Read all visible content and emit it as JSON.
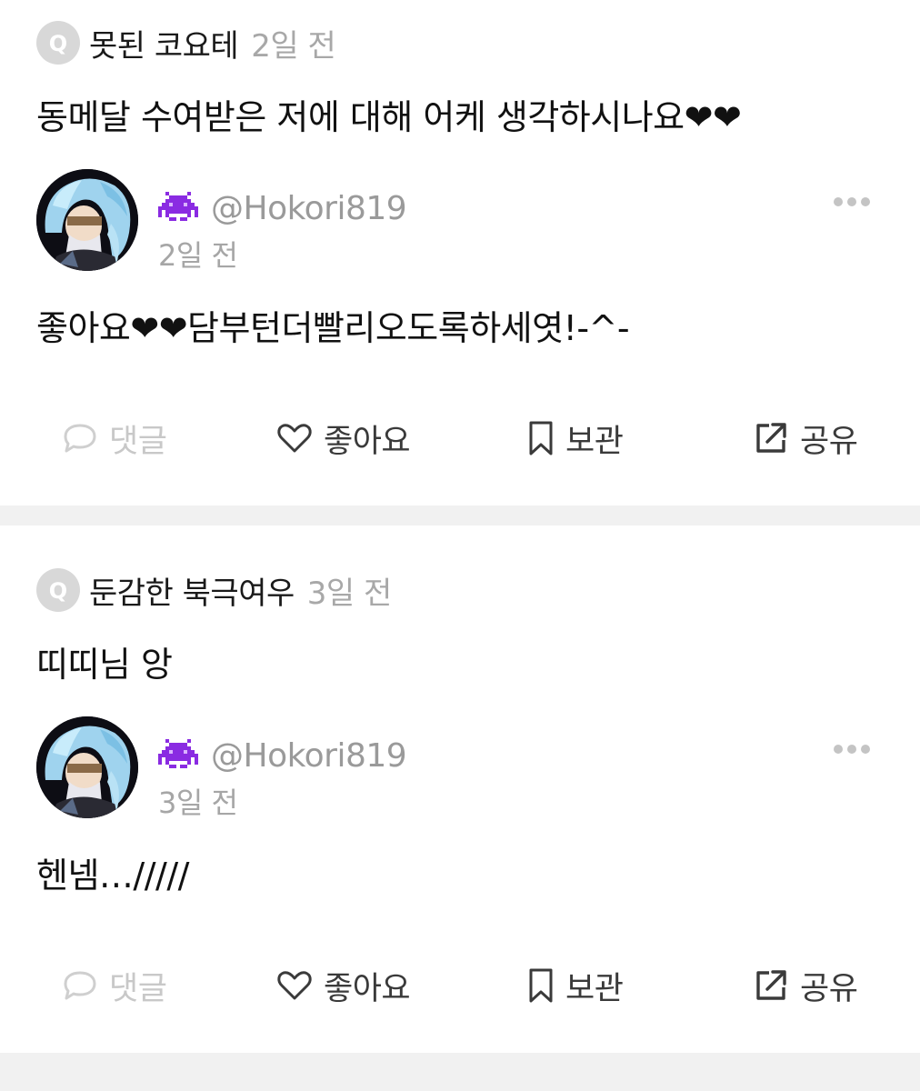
{
  "posts": [
    {
      "question": {
        "badge": "Q",
        "author": "못된 코요테",
        "time": "2일 전",
        "text": "동메달 수여받은 저에 대해 어케 생각하시나요❤❤"
      },
      "answer": {
        "handle": "@Hokori819",
        "time": "2일 전",
        "text": "좋아요❤❤담부턴더빨리오도록하세엿!-^-"
      },
      "actions": {
        "comment": "댓글",
        "like": "좋아요",
        "save": "보관",
        "share": "공유"
      }
    },
    {
      "question": {
        "badge": "Q",
        "author": "둔감한 북극여우",
        "time": "3일 전",
        "text": "띠띠님 앙"
      },
      "answer": {
        "handle": "@Hokori819",
        "time": "3일 전",
        "text": "헨넴…/////"
      },
      "actions": {
        "comment": "댓글",
        "like": "좋아요",
        "save": "보관",
        "share": "공유"
      }
    }
  ],
  "colors": {
    "primary_text": "#111111",
    "muted_text": "#a8a8a8",
    "disabled_text": "#c8c8c8",
    "badge_bg": "#d8d8d8",
    "pixel_icon": "#8a2be2",
    "divider": "#f1f1f1"
  },
  "icons": {
    "question_badge": "q-badge-icon",
    "user_badge": "pixel-alien-icon",
    "more": "more-dots-icon",
    "comment": "speech-bubble-icon",
    "like": "heart-outline-icon",
    "save": "bookmark-icon",
    "share": "share-external-icon"
  }
}
